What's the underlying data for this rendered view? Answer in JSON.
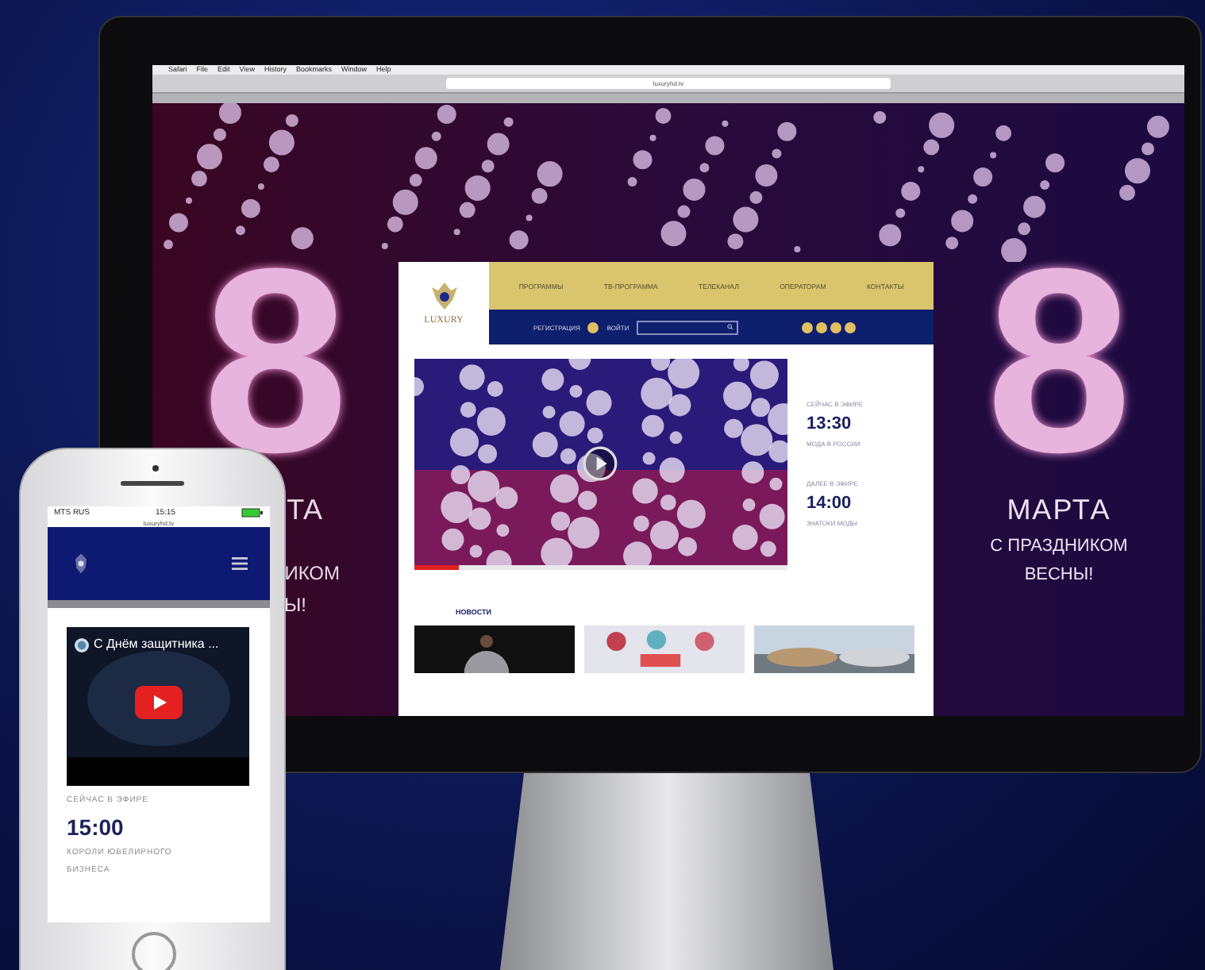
{
  "monitor": {
    "browser": {
      "menu_items": [
        "Safari",
        "File",
        "Edit",
        "View",
        "History",
        "Bookmarks",
        "Window",
        "Help"
      ],
      "address": "luxuryhd.tv"
    },
    "left_banner": {
      "numeral": "8",
      "lines": [
        "ТА",
        "ИКОМ",
        "Ы!"
      ]
    },
    "right_banner": {
      "numeral": "8",
      "title": "МАРТА",
      "greeting": [
        "С ПРАЗДНИКОМ",
        "ВЕСНЫ!"
      ]
    },
    "site": {
      "logo": "LUXURY",
      "nav": [
        "ПРОГРАММЫ",
        "ТВ-ПРОГРАММА",
        "ТЕЛЕКАНАЛ",
        "ОПЕРАТОРАМ",
        "КОНТАКТЫ"
      ],
      "register": "РЕГИСТРАЦИЯ",
      "login": "ВОЙТИ",
      "schedule": [
        {
          "label": "СЕЙЧАС В ЭФИРЕ",
          "time": "13:30",
          "show": "МОДА В РОССИИ"
        },
        {
          "label": "ДАЛЕЕ В ЭФИРЕ",
          "time": "14:00",
          "show": "ЗНАТОКИ МОДЫ"
        }
      ],
      "video": {
        "level": 0.12
      },
      "news_title": "НОВОСТИ"
    }
  },
  "phone": {
    "status": {
      "carrier": "MTS RUS",
      "time": "15:15"
    },
    "address": "luxuryhd.tv",
    "video_title": "С Днём защитника ...",
    "schedule": {
      "label": "СЕЙЧАС В ЭФИРЕ",
      "time": "15:00",
      "show": [
        "КОРОЛИ ЮВЕЛИРНОГО",
        "БИЗНЕСА"
      ]
    }
  }
}
